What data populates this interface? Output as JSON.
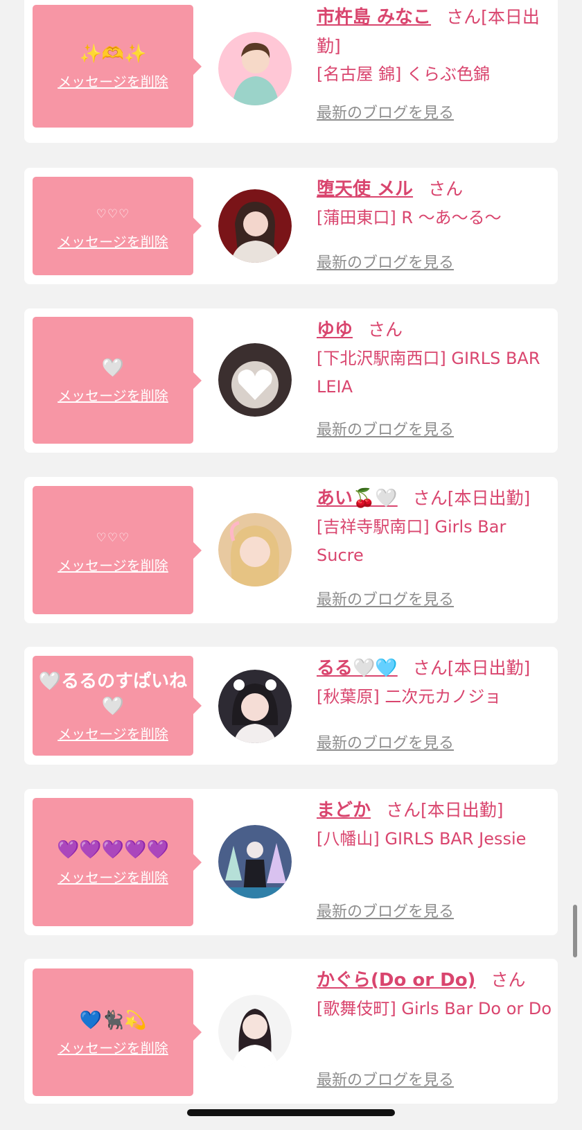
{
  "cards": [
    {
      "message": "✨🫶✨",
      "delete_label": "メッセージを削除",
      "name": "市杵島 みなこ",
      "honorific": "さん",
      "status": "[本日出勤]",
      "shop": "[名古屋 錦] くらぶ色錦",
      "blog_label": "最新のブログを見る",
      "avatar_color": "#ffc7d6"
    },
    {
      "message": "♡♡♡",
      "delete_label": "メッセージを削除",
      "name": "堕天使 メル",
      "honorific": "さん",
      "status": "",
      "shop": "[蒲田東口] R 〜あ〜る〜",
      "blog_label": "最新のブログを見る",
      "avatar_color": "#7a1418"
    },
    {
      "message": "🤍",
      "delete_label": "メッセージを削除",
      "name": "ゆゆ",
      "honorific": "さん",
      "status": "",
      "shop": "[下北沢駅南西口] GIRLS BAR LEIA",
      "blog_label": "最新のブログを見る",
      "avatar_color": "#3b2f2f"
    },
    {
      "message": "♡♡♡",
      "delete_label": "メッセージを削除",
      "name": "あい🍒🤍",
      "honorific": "さん",
      "status": "[本日出勤]",
      "shop": "[吉祥寺駅南口] Girls Bar Sucre",
      "blog_label": "最新のブログを見る",
      "avatar_color": "#e8c9a0"
    },
    {
      "message": "🤍るるのすぱいね🤍",
      "delete_label": "メッセージを削除",
      "name": "るる🤍🩵",
      "honorific": "さん",
      "status": "[本日出勤]",
      "shop": "[秋葉原] 二次元カノジョ",
      "blog_label": "最新のブログを見る",
      "avatar_color": "#2d2a33"
    },
    {
      "message": "💜💜💜💜💜",
      "delete_label": "メッセージを削除",
      "name": "まどか",
      "honorific": "さん",
      "status": "[本日出勤]",
      "shop": "[八幡山] GIRLS BAR Jessie",
      "blog_label": "最新のブログを見る",
      "avatar_color": "#4a5f8a"
    },
    {
      "message": "💙🐈‍⬛💫",
      "delete_label": "メッセージを削除",
      "name": "かぐら(Do or Do)",
      "honorific": "さん",
      "status": "",
      "shop": "[歌舞伎町] Girls Bar Do or Do",
      "blog_label": "最新のブログを見る",
      "avatar_color": "#f4f4f4"
    }
  ]
}
